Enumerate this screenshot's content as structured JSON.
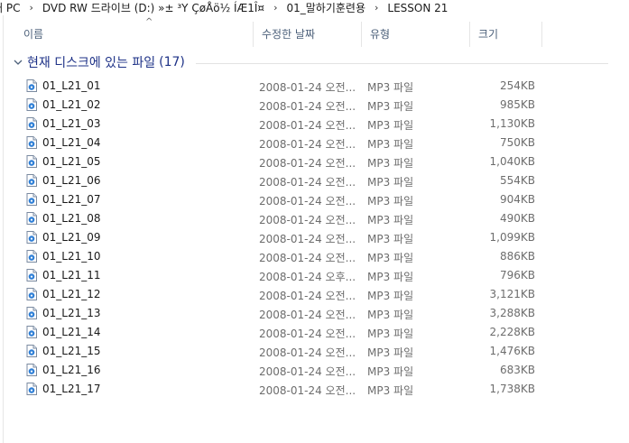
{
  "breadcrumb": {
    "segments": [
      "내 PC",
      "DVD RW 드라이브 (D:) »± ³Y ÇøÅö½ ÍÆ1Î¤",
      "01_말하기훈련용",
      "LESSON 21"
    ],
    "separator": "›"
  },
  "columns": {
    "name": "이름",
    "date": "수정한 날짜",
    "type": "유형",
    "size": "크기",
    "sort_indicator": "^"
  },
  "group": {
    "title": "현재 디스크에 있는 파일",
    "count": "(17)"
  },
  "files": [
    {
      "name": "01_L21_01",
      "date": "2008-01-24 오전...",
      "type": "MP3 파일",
      "size": "254KB"
    },
    {
      "name": "01_L21_02",
      "date": "2008-01-24 오전...",
      "type": "MP3 파일",
      "size": "985KB"
    },
    {
      "name": "01_L21_03",
      "date": "2008-01-24 오전...",
      "type": "MP3 파일",
      "size": "1,130KB"
    },
    {
      "name": "01_L21_04",
      "date": "2008-01-24 오전...",
      "type": "MP3 파일",
      "size": "750KB"
    },
    {
      "name": "01_L21_05",
      "date": "2008-01-24 오전...",
      "type": "MP3 파일",
      "size": "1,040KB"
    },
    {
      "name": "01_L21_06",
      "date": "2008-01-24 오전...",
      "type": "MP3 파일",
      "size": "554KB"
    },
    {
      "name": "01_L21_07",
      "date": "2008-01-24 오전...",
      "type": "MP3 파일",
      "size": "904KB"
    },
    {
      "name": "01_L21_08",
      "date": "2008-01-24 오전...",
      "type": "MP3 파일",
      "size": "490KB"
    },
    {
      "name": "01_L21_09",
      "date": "2008-01-24 오전...",
      "type": "MP3 파일",
      "size": "1,099KB"
    },
    {
      "name": "01_L21_10",
      "date": "2008-01-24 오전...",
      "type": "MP3 파일",
      "size": "886KB"
    },
    {
      "name": "01_L21_11",
      "date": "2008-01-24 오후...",
      "type": "MP3 파일",
      "size": "796KB"
    },
    {
      "name": "01_L21_12",
      "date": "2008-01-24 오전...",
      "type": "MP3 파일",
      "size": "3,121KB"
    },
    {
      "name": "01_L21_13",
      "date": "2008-01-24 오전...",
      "type": "MP3 파일",
      "size": "3,288KB"
    },
    {
      "name": "01_L21_14",
      "date": "2008-01-24 오전...",
      "type": "MP3 파일",
      "size": "2,228KB"
    },
    {
      "name": "01_L21_15",
      "date": "2008-01-24 오전...",
      "type": "MP3 파일",
      "size": "1,476KB"
    },
    {
      "name": "01_L21_16",
      "date": "2008-01-24 오전...",
      "type": "MP3 파일",
      "size": "683KB"
    },
    {
      "name": "01_L21_17",
      "date": "2008-01-24 오전...",
      "type": "MP3 파일",
      "size": "1,738KB"
    }
  ],
  "icons": {
    "file": "mp3-file-icon",
    "group_toggle": "chevron-down-icon"
  },
  "colors": {
    "group_title": "#1e3287",
    "header_text": "#4c607a",
    "detail_text": "#6d6d6d"
  }
}
